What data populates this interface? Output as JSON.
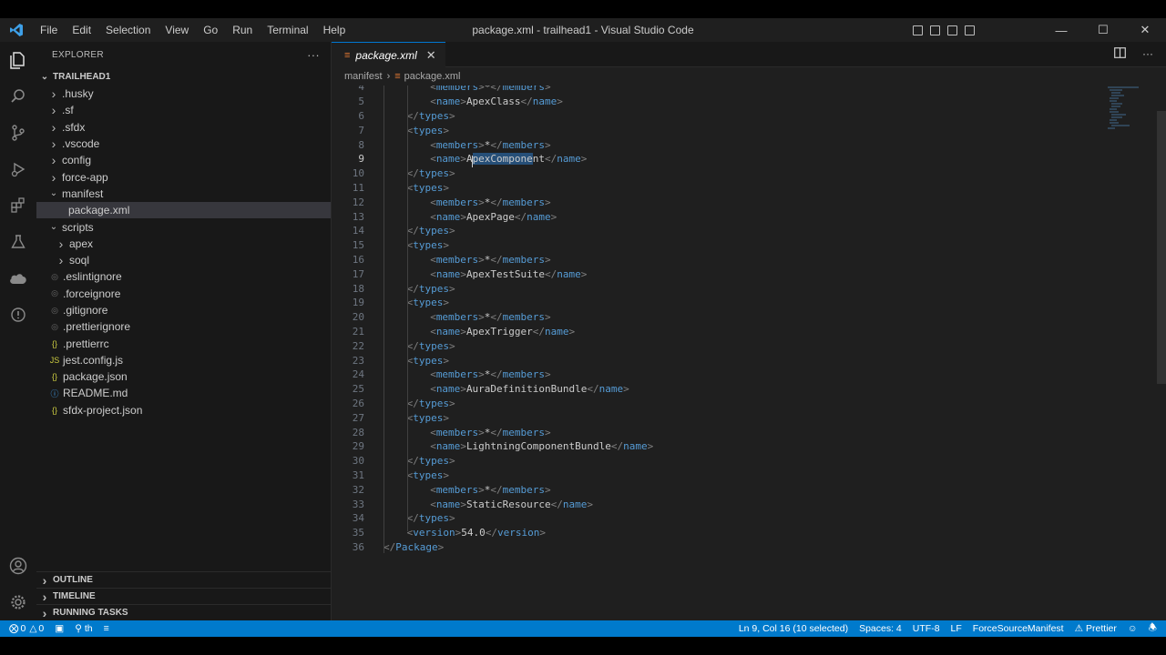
{
  "window": {
    "title": "package.xml - trailhead1 - Visual Studio Code",
    "menu": [
      "File",
      "Edit",
      "Selection",
      "View",
      "Go",
      "Run",
      "Terminal",
      "Help"
    ]
  },
  "sidebar": {
    "header": "EXPLORER",
    "more": "···",
    "root": "TRAILHEAD1",
    "items": [
      {
        "label": ".husky",
        "kind": "folder",
        "expanded": false,
        "depth": 1
      },
      {
        "label": ".sf",
        "kind": "folder",
        "expanded": false,
        "depth": 1
      },
      {
        "label": ".sfdx",
        "kind": "folder",
        "expanded": false,
        "depth": 1
      },
      {
        "label": ".vscode",
        "kind": "folder",
        "expanded": false,
        "depth": 1
      },
      {
        "label": "config",
        "kind": "folder",
        "expanded": false,
        "depth": 1
      },
      {
        "label": "force-app",
        "kind": "folder",
        "expanded": false,
        "depth": 1
      },
      {
        "label": "manifest",
        "kind": "folder",
        "expanded": true,
        "depth": 1
      },
      {
        "label": "package.xml",
        "kind": "xml",
        "depth": 2,
        "selected": true
      },
      {
        "label": "scripts",
        "kind": "folder",
        "expanded": true,
        "depth": 1
      },
      {
        "label": "apex",
        "kind": "folder",
        "expanded": false,
        "depth": 2
      },
      {
        "label": "soql",
        "kind": "folder",
        "expanded": false,
        "depth": 2
      },
      {
        "label": ".eslintignore",
        "kind": "ignore",
        "depth": 1
      },
      {
        "label": ".forceignore",
        "kind": "ignore",
        "depth": 1
      },
      {
        "label": ".gitignore",
        "kind": "ignore",
        "depth": 1
      },
      {
        "label": ".prettierignore",
        "kind": "ignore",
        "depth": 1
      },
      {
        "label": ".prettierrc",
        "kind": "json",
        "depth": 1
      },
      {
        "label": "jest.config.js",
        "kind": "js",
        "depth": 1
      },
      {
        "label": "package.json",
        "kind": "json",
        "depth": 1
      },
      {
        "label": "README.md",
        "kind": "info",
        "depth": 1
      },
      {
        "label": "sfdx-project.json",
        "kind": "json",
        "depth": 1
      }
    ],
    "sections": [
      "OUTLINE",
      "TIMELINE",
      "RUNNING TASKS"
    ]
  },
  "editor": {
    "tab": "package.xml",
    "breadcrumb": [
      "manifest",
      "package.xml"
    ],
    "lines": [
      {
        "n": "4",
        "indent": 2,
        "tag": "members",
        "value": "*"
      },
      {
        "n": "5",
        "indent": 2,
        "tag": "name",
        "value": "ApexClass"
      },
      {
        "n": "6",
        "indent": 1,
        "close": "types"
      },
      {
        "n": "7",
        "indent": 1,
        "open": "types"
      },
      {
        "n": "8",
        "indent": 2,
        "tag": "members",
        "value": "*"
      },
      {
        "n": "9",
        "indent": 2,
        "tag": "name",
        "value": "ApexComponent",
        "current": true
      },
      {
        "n": "10",
        "indent": 1,
        "close": "types"
      },
      {
        "n": "11",
        "indent": 1,
        "open": "types"
      },
      {
        "n": "12",
        "indent": 2,
        "tag": "members",
        "value": "*"
      },
      {
        "n": "13",
        "indent": 2,
        "tag": "name",
        "value": "ApexPage"
      },
      {
        "n": "14",
        "indent": 1,
        "close": "types"
      },
      {
        "n": "15",
        "indent": 1,
        "open": "types"
      },
      {
        "n": "16",
        "indent": 2,
        "tag": "members",
        "value": "*"
      },
      {
        "n": "17",
        "indent": 2,
        "tag": "name",
        "value": "ApexTestSuite"
      },
      {
        "n": "18",
        "indent": 1,
        "close": "types"
      },
      {
        "n": "19",
        "indent": 1,
        "open": "types"
      },
      {
        "n": "20",
        "indent": 2,
        "tag": "members",
        "value": "*"
      },
      {
        "n": "21",
        "indent": 2,
        "tag": "name",
        "value": "ApexTrigger"
      },
      {
        "n": "22",
        "indent": 1,
        "close": "types"
      },
      {
        "n": "23",
        "indent": 1,
        "open": "types"
      },
      {
        "n": "24",
        "indent": 2,
        "tag": "members",
        "value": "*"
      },
      {
        "n": "25",
        "indent": 2,
        "tag": "name",
        "value": "AuraDefinitionBundle"
      },
      {
        "n": "26",
        "indent": 1,
        "close": "types"
      },
      {
        "n": "27",
        "indent": 1,
        "open": "types"
      },
      {
        "n": "28",
        "indent": 2,
        "tag": "members",
        "value": "*"
      },
      {
        "n": "29",
        "indent": 2,
        "tag": "name",
        "value": "LightningComponentBundle"
      },
      {
        "n": "30",
        "indent": 1,
        "close": "types"
      },
      {
        "n": "31",
        "indent": 1,
        "open": "types"
      },
      {
        "n": "32",
        "indent": 2,
        "tag": "members",
        "value": "*"
      },
      {
        "n": "33",
        "indent": 2,
        "tag": "name",
        "value": "StaticResource"
      },
      {
        "n": "34",
        "indent": 1,
        "close": "types"
      },
      {
        "n": "35",
        "indent": 1,
        "tag": "version",
        "value": "54.0"
      },
      {
        "n": "36",
        "indent": 0,
        "close": "Package"
      }
    ]
  },
  "statusbar": {
    "errors": "0",
    "warnings": "0",
    "branch": "th",
    "position": "Ln 9, Col 16 (10 selected)",
    "spaces": "Spaces: 4",
    "encoding": "UTF-8",
    "eol": "LF",
    "manifest": "ForceSourceManifest",
    "formatter": "Prettier"
  },
  "colors": {
    "accent": "#007acc",
    "tag": "#569cd6",
    "selection": "#264f78"
  }
}
